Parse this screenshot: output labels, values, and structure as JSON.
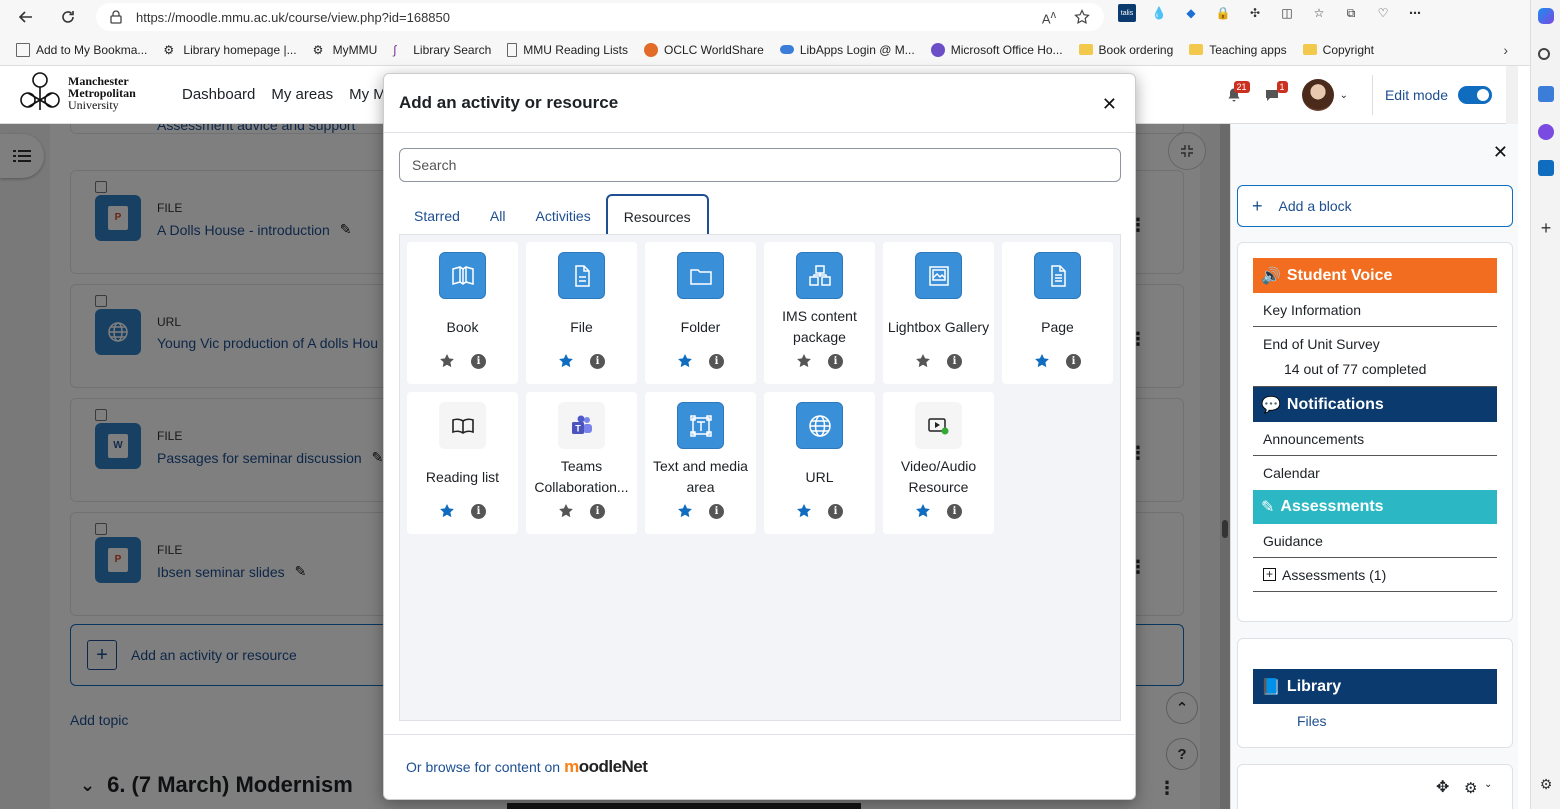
{
  "browser": {
    "url": "https://moodle.mmu.ac.uk/course/view.php?id=168850",
    "bookmarks": [
      "Add to My Bookma...",
      "Library homepage |...",
      "MyMMU",
      "Library Search",
      "MMU Reading Lists",
      "OCLC WorldShare",
      "LibApps Login @ M...",
      "Microsoft Office Ho...",
      "Book ordering",
      "Teaching apps",
      "Copyright"
    ],
    "ext_label": "talis"
  },
  "site": {
    "logo_lines": [
      "Manchester",
      "Metropolitan",
      "University"
    ],
    "nav": [
      "Dashboard",
      "My areas",
      "My Me"
    ],
    "notifications_count": "21",
    "messages_count": "1",
    "edit_mode_label": "Edit mode",
    "accent": "#0f6cbf"
  },
  "course": {
    "partial_item": "Assessment advice and support",
    "activities": [
      {
        "type": "FILE",
        "name": "A Dolls House - introduction"
      },
      {
        "type": "URL",
        "name": "Young Vic production of A dolls Hou"
      },
      {
        "type": "FILE",
        "name": "Passages for seminar discussion"
      },
      {
        "type": "FILE",
        "name": "Ibsen seminar slides"
      }
    ],
    "add_activity": "Add an activity or resource",
    "add_topic": "Add topic",
    "next_section": "6. (7 March) Modernism"
  },
  "modal": {
    "title": "Add an activity or resource",
    "search_placeholder": "Search",
    "tabs": [
      "Starred",
      "All",
      "Activities",
      "Resources"
    ],
    "active_tab": "Resources",
    "items": [
      {
        "name": "Book",
        "starred": false
      },
      {
        "name": "File",
        "starred": true
      },
      {
        "name": "Folder",
        "starred": true
      },
      {
        "name": "IMS content package",
        "starred": false
      },
      {
        "name": "Lightbox Gallery",
        "starred": false
      },
      {
        "name": "Page",
        "starred": true
      },
      {
        "name": "Reading list",
        "starred": true
      },
      {
        "name": "Teams Collaboration...",
        "starred": false
      },
      {
        "name": "Text and media area",
        "starred": true
      },
      {
        "name": "URL",
        "starred": true
      },
      {
        "name": "Video/Audio Resource",
        "starred": true
      }
    ],
    "footer_text": "Or browse for content on",
    "moodlenet_m": "m",
    "moodlenet_rest": "oodleNet"
  },
  "drawer": {
    "add_block": "Add a block",
    "student_voice": {
      "title": "Student Voice",
      "color": "#f26d1f",
      "rows": [
        "Key Information",
        "End of Unit Survey"
      ],
      "progress": "14 out of 77 completed"
    },
    "notifications": {
      "title": "Notifications",
      "color": "#0b3a6e",
      "rows": [
        "Announcements",
        "Calendar"
      ]
    },
    "assessments": {
      "title": "Assessments",
      "color": "#2bb7c4",
      "rows": [
        "Guidance",
        "Assessments (1)"
      ]
    },
    "library": {
      "title": "Library",
      "color": "#0b3a6e",
      "rows": [
        "Files"
      ]
    }
  }
}
